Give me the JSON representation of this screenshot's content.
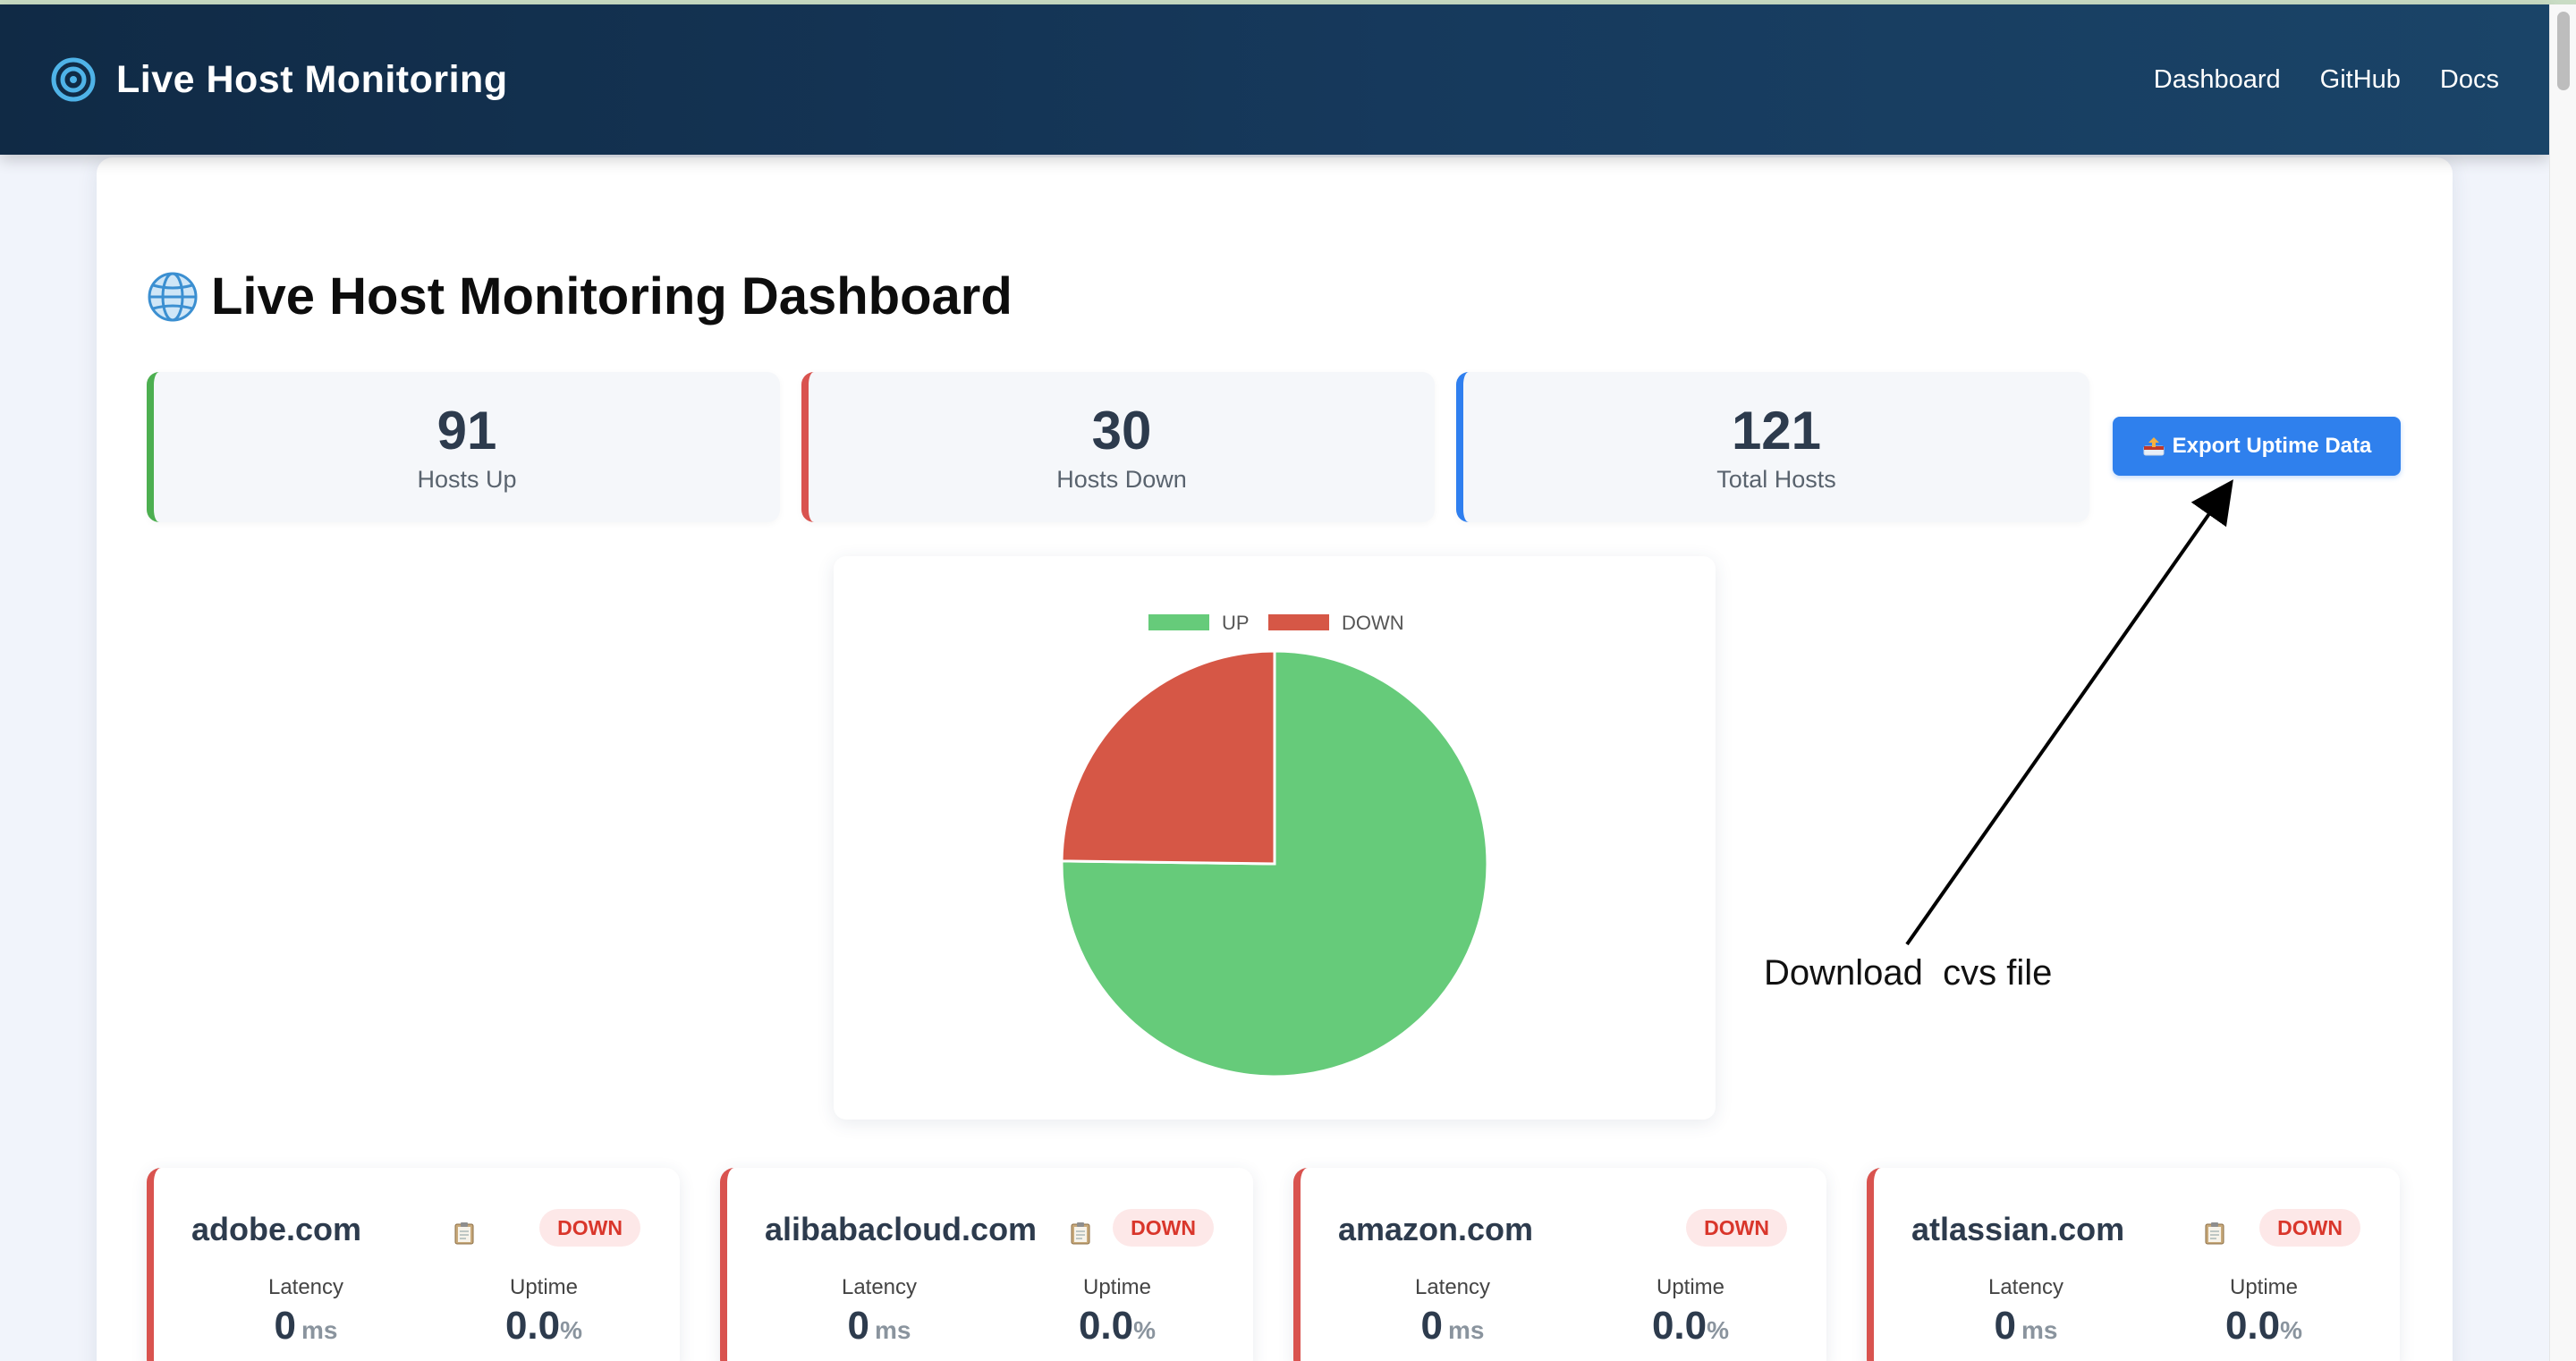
{
  "header": {
    "title": "Live Host Monitoring",
    "nav": [
      "Dashboard",
      "GitHub",
      "Docs"
    ]
  },
  "page": {
    "title": "Live Host Monitoring Dashboard"
  },
  "stats": {
    "up": {
      "value": "91",
      "label": "Hosts Up",
      "color": "#4caf50"
    },
    "down": {
      "value": "30",
      "label": "Hosts Down",
      "color": "#d9534f"
    },
    "total": {
      "value": "121",
      "label": "Total Hosts",
      "color": "#2f7fef"
    }
  },
  "export_button": {
    "label": "Export Uptime Data"
  },
  "chart_data": {
    "type": "pie",
    "categories": [
      "UP",
      "DOWN"
    ],
    "values": [
      91,
      30
    ],
    "colors": [
      "#66cb7a",
      "#d65746"
    ],
    "legend": "top"
  },
  "annotation": {
    "text": "Download  cvs file"
  },
  "hosts": [
    {
      "name": "adobe.com",
      "status": "DOWN",
      "latency_label": "Latency",
      "latency": "0",
      "latency_unit": "ms",
      "uptime_label": "Uptime",
      "uptime": "0.0",
      "uptime_unit": "%"
    },
    {
      "name": "alibabacloud.com",
      "status": "DOWN",
      "latency_label": "Latency",
      "latency": "0",
      "latency_unit": "ms",
      "uptime_label": "Uptime",
      "uptime": "0.0",
      "uptime_unit": "%"
    },
    {
      "name": "amazon.com",
      "status": "DOWN",
      "latency_label": "Latency",
      "latency": "0",
      "latency_unit": "ms",
      "uptime_label": "Uptime",
      "uptime": "0.0",
      "uptime_unit": "%"
    },
    {
      "name": "atlassian.com",
      "status": "DOWN",
      "latency_label": "Latency",
      "latency": "0",
      "latency_unit": "ms",
      "uptime_label": "Uptime",
      "uptime": "0.0",
      "uptime_unit": "%"
    }
  ]
}
